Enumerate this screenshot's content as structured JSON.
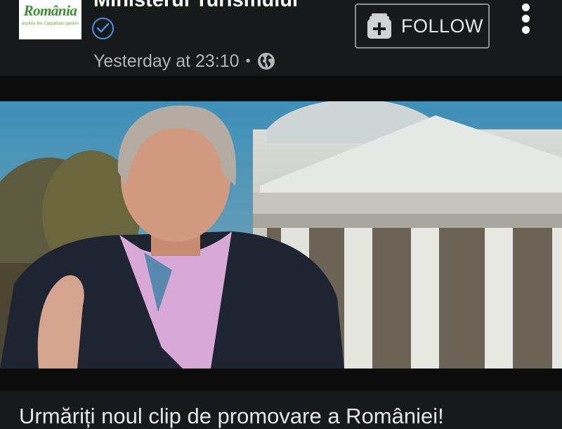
{
  "post": {
    "page_name": "Ministerul Turismului",
    "timestamp": "Yesterday at 23:10",
    "separator": "•",
    "audience_icon": "globe-icon",
    "verified_icon": "verified-check-icon",
    "caption": "Urmăriți noul clip de promovare a României!"
  },
  "logo": {
    "wordmark": "România",
    "tagline": "explore the Carpathian garden"
  },
  "follow": {
    "label": "FOLLOW",
    "icon": "add-page-icon"
  },
  "menu": {
    "icon": "more-vertical-icon"
  },
  "colors": {
    "background": "#18191a",
    "band": "#0c0c0d",
    "verified": "#4a90e2",
    "text": "#e4e6eb",
    "muted": "#b0b3b8"
  }
}
